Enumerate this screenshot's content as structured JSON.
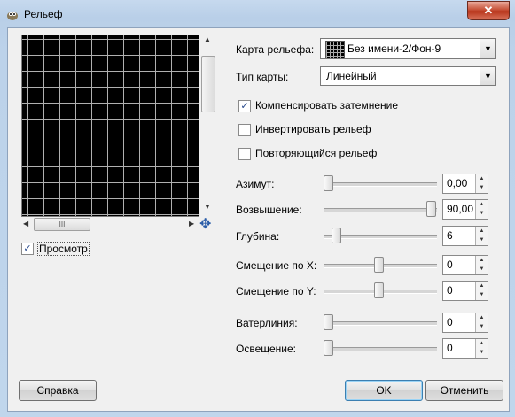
{
  "window": {
    "title": "Рельеф",
    "close_glyph": "✕"
  },
  "map": {
    "label": "Карта рельефа:",
    "value": "Без имени-2/Фон-9",
    "type_label": "Тип карты:",
    "type_value": "Линейный"
  },
  "options": {
    "compensate": {
      "label": "Компенсировать затемнение",
      "checked": true
    },
    "invert": {
      "label": "Инвертировать рельеф",
      "checked": false
    },
    "tile": {
      "label": "Повторяющийся рельеф",
      "checked": false
    }
  },
  "sliders": {
    "azimuth": {
      "label": "Азимут:",
      "value": "0,00"
    },
    "elevation": {
      "label": "Возвышение:",
      "value": "90,00"
    },
    "depth": {
      "label": "Глубина:",
      "value": "6"
    },
    "offset_x": {
      "label": "Смещение по X:",
      "value": "0"
    },
    "offset_y": {
      "label": "Смещение по Y:",
      "value": "0"
    },
    "waterline": {
      "label": "Ватерлиния:",
      "value": "0"
    },
    "ambient": {
      "label": "Освещение:",
      "value": "0"
    }
  },
  "preview": {
    "label": "Просмотр",
    "checked": true,
    "hscroll_grip": "III"
  },
  "buttons": {
    "help": "Справка",
    "ok": "OK",
    "cancel": "Отменить"
  },
  "icons": {
    "check": "✓",
    "arrow_up": "▲",
    "arrow_down": "▼",
    "arrow_left": "◀",
    "arrow_right": "▶",
    "move": "✥"
  }
}
